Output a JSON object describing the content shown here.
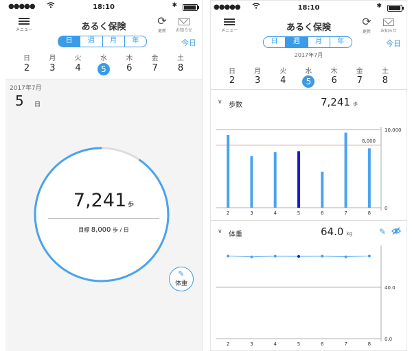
{
  "status": {
    "signal": "●●●●●",
    "time": "18:10",
    "battery_level": 0.85
  },
  "nav": {
    "menu_label": "メニュー",
    "title": "あるく保険",
    "refresh_label": "更新",
    "mail_label": "お知らせ"
  },
  "segments": [
    "日",
    "週",
    "月",
    "年"
  ],
  "today_label": "今日",
  "weekdays": [
    "日",
    "月",
    "火",
    "水",
    "木",
    "金",
    "土"
  ],
  "dates": [
    "2",
    "3",
    "4",
    "5",
    "6",
    "7",
    "8"
  ],
  "left": {
    "active_segment": 0,
    "month": "2017年7月",
    "day": "5",
    "day_unit": "日",
    "steps": "7,241",
    "steps_unit": "歩",
    "target_prefix": "目標",
    "target_value": "8,000",
    "target_suffix": "歩 / 日",
    "progress": 0.905,
    "weight_button": "体重"
  },
  "right": {
    "active_segment": 1,
    "month": "2017年7月",
    "steps_title": "歩数",
    "steps_value": "7,241",
    "steps_unit": "歩",
    "weight_title": "体重",
    "weight_value": "64.0",
    "weight_unit": "kg"
  },
  "chart_data": [
    {
      "type": "bar",
      "categories": [
        "2",
        "3",
        "4",
        "5",
        "6",
        "7",
        "8"
      ],
      "values": [
        9300,
        6600,
        7100,
        7241,
        4600,
        9600,
        7600
      ],
      "highlight_index": 3,
      "ylim": [
        0,
        10000
      ],
      "yticks": [
        "0",
        "10,000"
      ],
      "target": 8000,
      "target_label": "8,000",
      "colors": {
        "bar": "#4aa3ee",
        "highlight": "#1a1ad6",
        "target": "#e88a8a"
      }
    },
    {
      "type": "line",
      "categories": [
        "2",
        "3",
        "4",
        "5",
        "6",
        "7",
        "8"
      ],
      "values": [
        64.3,
        63.6,
        64.2,
        64.0,
        64.2,
        63.7,
        64.3
      ],
      "highlight_index": 3,
      "ylim": [
        0,
        80
      ],
      "yticks": [
        "0.0",
        "40.0"
      ],
      "colors": {
        "line": "#4aa3ee",
        "highlight": "#1a1ad6"
      }
    }
  ]
}
